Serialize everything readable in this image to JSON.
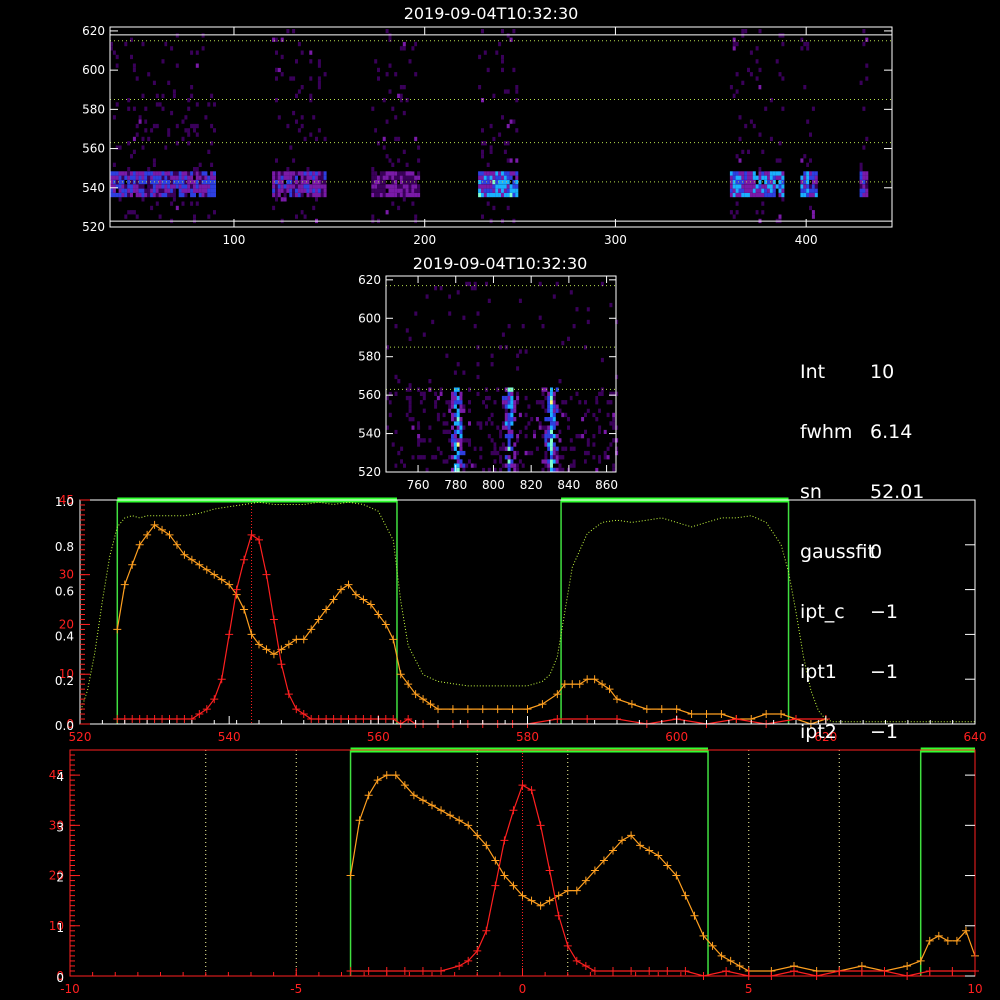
{
  "info_panel": [
    {
      "key": "Int",
      "value": "10"
    },
    {
      "key": "fwhm",
      "value": "6.14"
    },
    {
      "key": "sn",
      "value": "52.01"
    },
    {
      "key": "gaussfit",
      "value": "0"
    },
    {
      "key": "ipt_c",
      "value": "−1"
    },
    {
      "key": "ipt1",
      "value": "−1"
    },
    {
      "key": "ipt2",
      "value": "−1"
    }
  ],
  "chart_data": [
    {
      "type": "heatmap",
      "title": "2019-09-04T10:32:30",
      "xlim": [
        35,
        445
      ],
      "ylim": [
        520,
        622
      ],
      "xticks": [
        100,
        200,
        300,
        400
      ],
      "yticks": [
        520,
        540,
        560,
        580,
        600,
        620
      ],
      "hlines": [
        543,
        563,
        585,
        615
      ],
      "bright_band_y": [
        535,
        548
      ],
      "segments": [
        [
          35,
          90
        ],
        [
          120,
          148
        ],
        [
          172,
          197
        ],
        [
          228,
          248
        ],
        [
          360,
          388
        ],
        [
          397,
          405
        ],
        [
          428,
          432
        ]
      ],
      "segment_intensity": [
        0.7,
        0.6,
        0.5,
        0.9,
        0.85,
        0.8,
        0.6
      ],
      "colorscale": [
        "#000000",
        "#3a005a",
        "#7a1aa8",
        "#2d3fe0",
        "#1ab0ff",
        "#7fffd0",
        "#ffff80"
      ]
    },
    {
      "type": "heatmap",
      "title": "2019-09-04T10:32:30",
      "xlim": [
        743,
        865
      ],
      "ylim": [
        520,
        622
      ],
      "xticks": [
        760,
        780,
        800,
        820,
        840,
        860
      ],
      "yticks": [
        520,
        540,
        560,
        580,
        600,
        620
      ],
      "hlines": [
        563,
        585,
        617
      ],
      "streak_x": [
        780,
        808,
        830
      ],
      "colorscale": [
        "#000000",
        "#3a005a",
        "#7a1aa8",
        "#2d3fe0",
        "#1ab0ff",
        "#7fffd0",
        "#ffff80"
      ]
    },
    {
      "type": "line",
      "xlim": [
        520,
        640
      ],
      "ylim": [
        0,
        45
      ],
      "ylim_right_axis": [
        0,
        1
      ],
      "xticks": [
        520,
        540,
        560,
        580,
        600,
        620,
        640
      ],
      "yticks_left": [
        0,
        10,
        20,
        30,
        45
      ],
      "yticks_left_labels": [
        "0",
        "10",
        "20",
        "30",
        "45"
      ],
      "yticks_right_scale": [
        0,
        0.2,
        0.4,
        0.6,
        0.8,
        1.0
      ],
      "yticks_right_scale_labels": [
        "0.0",
        "0.2",
        "0.4",
        "0.6",
        "0.8",
        "1.0"
      ],
      "center_line_x": 543,
      "windows": [
        [
          525,
          562.5
        ],
        [
          584.5,
          615
        ]
      ],
      "series": [
        {
          "color": "#ffa020",
          "x": [
            525,
            526,
            527,
            528,
            529,
            530,
            531,
            532,
            533,
            534,
            535,
            536,
            537,
            538,
            539,
            540,
            541,
            542,
            543,
            544,
            545,
            546,
            547,
            548,
            549,
            550,
            551,
            552,
            553,
            554,
            555,
            556,
            557,
            558,
            559,
            560,
            561,
            562,
            563,
            564,
            565,
            566,
            567,
            568,
            570,
            572,
            574,
            576,
            578,
            580,
            582,
            584,
            585,
            586,
            587,
            588,
            589,
            590,
            591,
            592,
            594,
            596,
            598,
            600,
            602,
            604,
            606,
            608,
            610,
            612,
            614,
            616,
            618,
            620
          ],
          "y": [
            19,
            28,
            32,
            36,
            38,
            40,
            39,
            38,
            36,
            34,
            33,
            32,
            31,
            30,
            29,
            28,
            26,
            23,
            18,
            16,
            15,
            14,
            15,
            16,
            17,
            17,
            19,
            21,
            23,
            25,
            27,
            28,
            26,
            25,
            24,
            22,
            20,
            17,
            10,
            8,
            6,
            5,
            4,
            3,
            3,
            3,
            3,
            3,
            3,
            3,
            4,
            6,
            8,
            8,
            8,
            9,
            9,
            8,
            7,
            5,
            4,
            3,
            3,
            3,
            2,
            2,
            2,
            1,
            1,
            2,
            2,
            1,
            0,
            1
          ]
        },
        {
          "color": "#ff2020",
          "x": [
            525,
            526,
            527,
            528,
            529,
            530,
            531,
            532,
            533,
            534,
            535,
            536,
            537,
            538,
            539,
            540,
            541,
            542,
            543,
            544,
            545,
            546,
            547,
            548,
            549,
            550,
            551,
            552,
            553,
            554,
            555,
            556,
            557,
            558,
            559,
            560,
            561,
            562,
            563,
            564,
            565,
            566,
            568,
            570,
            572,
            574,
            576,
            578,
            580,
            584,
            588,
            592,
            596,
            600,
            604,
            608,
            612,
            616,
            620
          ],
          "y": [
            1,
            1,
            1,
            1,
            1,
            1,
            1,
            1,
            1,
            1,
            1,
            2,
            3,
            5,
            9,
            18,
            27,
            33,
            38,
            37,
            30,
            21,
            12,
            6,
            3,
            2,
            1,
            1,
            1,
            1,
            1,
            1,
            1,
            1,
            1,
            1,
            1,
            1,
            0,
            1,
            0,
            0,
            0,
            0,
            0,
            0,
            0,
            0,
            0,
            1,
            1,
            1,
            0,
            1,
            0,
            1,
            0,
            1,
            1
          ]
        },
        {
          "name_dotted": "",
          "color": "#c8ff40",
          "dotted": true,
          "axis": "right",
          "x": [
            520,
            521,
            522,
            523,
            524,
            525,
            526,
            527,
            528,
            529,
            530,
            532,
            534,
            536,
            538,
            540,
            542,
            544,
            546,
            548,
            550,
            552,
            554,
            556,
            558,
            560,
            562,
            563,
            564,
            566,
            568,
            570,
            572,
            574,
            576,
            578,
            580,
            582,
            583,
            584,
            585,
            586,
            588,
            590,
            592,
            594,
            596,
            598,
            600,
            602,
            604,
            606,
            608,
            610,
            612,
            614,
            615,
            616,
            617,
            618,
            619,
            620,
            621,
            622,
            624,
            630,
            636,
            640
          ],
          "y": [
            0.05,
            0.15,
            0.32,
            0.55,
            0.75,
            0.88,
            0.92,
            0.93,
            0.92,
            0.93,
            0.93,
            0.93,
            0.93,
            0.94,
            0.96,
            0.97,
            0.98,
            0.99,
            0.98,
            0.98,
            0.98,
            0.99,
            0.98,
            0.99,
            0.98,
            0.95,
            0.82,
            0.55,
            0.35,
            0.22,
            0.19,
            0.18,
            0.17,
            0.17,
            0.17,
            0.17,
            0.17,
            0.19,
            0.22,
            0.3,
            0.5,
            0.7,
            0.85,
            0.9,
            0.91,
            0.9,
            0.91,
            0.92,
            0.9,
            0.88,
            0.9,
            0.92,
            0.92,
            0.93,
            0.9,
            0.8,
            0.68,
            0.5,
            0.3,
            0.15,
            0.06,
            0.02,
            0.01,
            0.01,
            0.01,
            0.01,
            0.01,
            0.01
          ]
        }
      ]
    },
    {
      "type": "line",
      "xlim": [
        -10,
        10
      ],
      "ylim": [
        0,
        45
      ],
      "xticks": [
        -10,
        -5,
        0,
        5,
        10
      ],
      "yticks_left": [
        0,
        10,
        20,
        30,
        40
      ],
      "yticks_left_labels": [
        "0",
        "10",
        "20",
        "30",
        "45"
      ],
      "yticks_right_scale": [
        0,
        1,
        2,
        3,
        4
      ],
      "yticks_right_scale_labels": [
        "0",
        "1",
        "2",
        "3",
        "4"
      ],
      "vlines_dotted": [
        -7,
        -5,
        -1,
        1,
        5,
        7
      ],
      "center_line_x": 0,
      "windows": [
        [
          -3.8,
          4.1
        ],
        [
          8.8,
          10
        ]
      ],
      "series": [
        {
          "color": "#ffa020",
          "x": [
            -3.8,
            -3.6,
            -3.4,
            -3.2,
            -3.0,
            -2.8,
            -2.6,
            -2.4,
            -2.2,
            -2.0,
            -1.8,
            -1.6,
            -1.4,
            -1.2,
            -1.0,
            -0.8,
            -0.6,
            -0.4,
            -0.2,
            0.0,
            0.2,
            0.4,
            0.6,
            0.8,
            1.0,
            1.2,
            1.4,
            1.6,
            1.8,
            2.0,
            2.2,
            2.4,
            2.6,
            2.8,
            3.0,
            3.2,
            3.4,
            3.6,
            3.8,
            4.0,
            4.2,
            4.4,
            4.6,
            4.8,
            5.0,
            5.5,
            6.0,
            6.5,
            7.0,
            7.5,
            8.0,
            8.5,
            8.8,
            9.0,
            9.2,
            9.4,
            9.6,
            9.8,
            10.0
          ],
          "y": [
            20,
            31,
            36,
            39,
            40,
            40,
            38,
            36,
            35,
            34,
            33,
            32,
            31,
            30,
            28,
            26,
            23,
            20,
            18,
            16,
            15,
            14,
            15,
            16,
            17,
            17,
            19,
            21,
            23,
            25,
            27,
            28,
            26,
            25,
            24,
            22,
            20,
            16,
            12,
            8,
            6,
            4,
            3,
            2,
            1,
            1,
            2,
            1,
            1,
            2,
            1,
            2,
            3,
            7,
            8,
            7,
            7,
            9,
            4
          ]
        },
        {
          "color": "#ff2020",
          "x": [
            -3.8,
            -3.4,
            -3.0,
            -2.6,
            -2.2,
            -1.8,
            -1.4,
            -1.2,
            -1.0,
            -0.8,
            -0.6,
            -0.4,
            -0.2,
            0.0,
            0.2,
            0.4,
            0.6,
            0.8,
            1.0,
            1.2,
            1.4,
            1.6,
            2.0,
            2.4,
            2.8,
            3.2,
            3.6,
            4.0,
            4.5,
            5.0,
            5.5,
            6.0,
            6.5,
            7.0,
            7.5,
            8.0,
            8.5,
            9.0,
            9.5,
            10.0
          ],
          "y": [
            1,
            1,
            1,
            1,
            1,
            1,
            2,
            3,
            5,
            9,
            18,
            27,
            33,
            38,
            37,
            30,
            21,
            12,
            6,
            3,
            2,
            1,
            1,
            1,
            1,
            1,
            1,
            0,
            1,
            0,
            0,
            1,
            0,
            1,
            1,
            1,
            0,
            1,
            1,
            1
          ]
        }
      ]
    }
  ]
}
